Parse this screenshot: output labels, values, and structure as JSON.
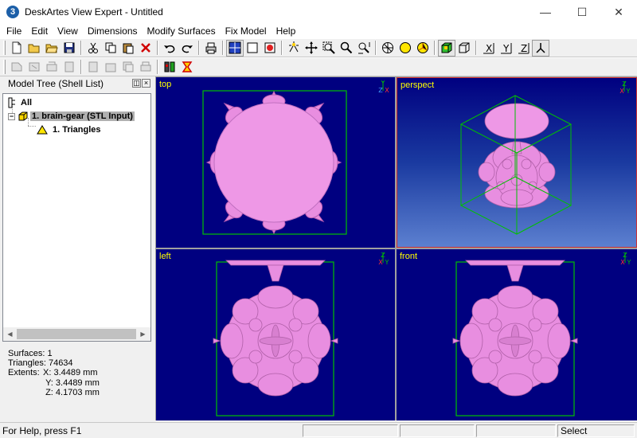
{
  "window": {
    "title": "DeskArtes View Expert - Untitled",
    "minimize": "—",
    "maximize": "☐",
    "close": "✕"
  },
  "menu": [
    "File",
    "Edit",
    "View",
    "Dimensions",
    "Modify Surfaces",
    "Fix Model",
    "Help"
  ],
  "toolbar1": [
    {
      "name": "new-icon"
    },
    {
      "name": "open-icon"
    },
    {
      "name": "open-folder-icon"
    },
    {
      "name": "save-icon"
    },
    {
      "sep": true
    },
    {
      "name": "cut-icon"
    },
    {
      "name": "copy-icon"
    },
    {
      "name": "paste-icon"
    },
    {
      "name": "delete-icon"
    },
    {
      "sep": true
    },
    {
      "name": "undo-icon"
    },
    {
      "name": "redo-icon"
    },
    {
      "sep": true
    },
    {
      "name": "print-icon"
    },
    {
      "sep": true
    },
    {
      "name": "four-views-icon",
      "pressed": true
    },
    {
      "name": "single-view-icon"
    },
    {
      "name": "render-mode-icon"
    },
    {
      "sep": true
    },
    {
      "name": "select-icon"
    },
    {
      "name": "pan-icon"
    },
    {
      "name": "zoom-window-icon"
    },
    {
      "name": "zoom-icon"
    },
    {
      "name": "zoom-fit-icon"
    },
    {
      "sep": true
    },
    {
      "name": "rotate-icon"
    },
    {
      "name": "shade-icon"
    },
    {
      "name": "light-icon"
    },
    {
      "sep": true
    },
    {
      "name": "solid-box-icon",
      "pressed": true
    },
    {
      "name": "wire-box-icon"
    },
    {
      "sep": true
    },
    {
      "name": "view-x-icon"
    },
    {
      "name": "view-y-icon"
    },
    {
      "name": "view-z-icon"
    },
    {
      "name": "view-iso-icon",
      "pressed": true
    }
  ],
  "toolbar2": [
    {
      "name": "surface-tool-1-icon",
      "disabled": true
    },
    {
      "name": "surface-tool-2-icon",
      "disabled": true
    },
    {
      "name": "surface-tool-3-icon",
      "disabled": true
    },
    {
      "name": "surface-tool-4-icon",
      "disabled": true
    },
    {
      "sep": true
    },
    {
      "name": "slice-tool-1-icon",
      "disabled": true
    },
    {
      "name": "slice-tool-2-icon",
      "disabled": true
    },
    {
      "name": "slice-tool-3-icon",
      "disabled": true
    },
    {
      "name": "slice-tool-4-icon",
      "disabled": true
    },
    {
      "sep": true
    },
    {
      "name": "cap-holes-icon"
    },
    {
      "name": "clear-icon"
    }
  ],
  "model_tree": {
    "title": "Model Tree (Shell List)",
    "root": "All",
    "shell": "1. brain-gear (STL Input)",
    "child": "1. Triangles"
  },
  "stats": {
    "surfaces_label": "Surfaces:",
    "surfaces": "1",
    "triangles_label": "Triangles:",
    "triangles": "74634",
    "extents_label": "Extents:",
    "x": "X: 3.4489 mm",
    "y": "Y: 3.4489 mm",
    "z": "Z: 4.1703 mm"
  },
  "viewports": [
    {
      "id": "top",
      "label": "top",
      "axes": [
        "Y",
        "ZX"
      ],
      "active": false
    },
    {
      "id": "perspect",
      "label": "perspect",
      "axes": [
        "Z",
        "XY"
      ],
      "active": true
    },
    {
      "id": "left",
      "label": "left",
      "axes": [
        "Z",
        "XY"
      ],
      "active": false
    },
    {
      "id": "front",
      "label": "front",
      "axes": [
        "Z",
        "XY"
      ],
      "active": false
    }
  ],
  "colors": {
    "viewport_bg": "#000080",
    "model": "#e88ee0",
    "model_shadow": "#b85cb0",
    "bbox": "#00c000",
    "active_border": "#d03030",
    "label": "#ffff00"
  },
  "status": {
    "help": "For Help, press F1",
    "mode": "Select"
  }
}
